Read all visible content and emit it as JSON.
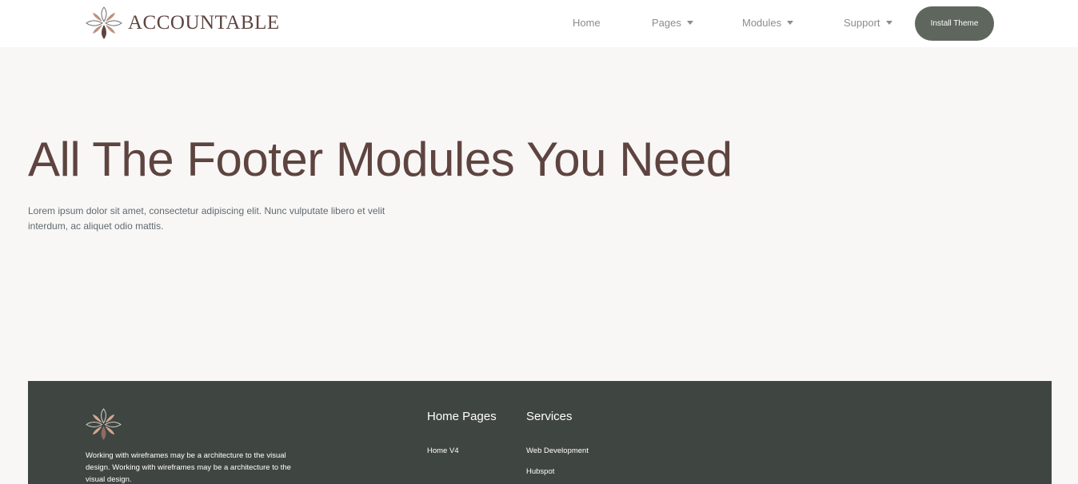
{
  "header": {
    "logo_text": "ACCOUNTABLE",
    "nav": [
      {
        "label": "Home"
      },
      {
        "label": "Pages"
      },
      {
        "label": "Modules"
      },
      {
        "label": "Support"
      }
    ],
    "cta_label": "Install Theme"
  },
  "hero": {
    "title": "All The Footer Modules You Need",
    "text": "Lorem ipsum dolor sit amet, consectetur adipiscing elit. Nunc vulputate libero et velit interdum, ac aliquet odio mattis."
  },
  "footer": {
    "description": "Working with wireframes may be a architecture to the visual design. Working with wireframes may be a architecture to the visual design.",
    "columns": [
      {
        "heading": "Home Pages",
        "links": [
          "Home V4"
        ]
      },
      {
        "heading": "Services",
        "links": [
          "Web Development",
          "Hubspot"
        ]
      }
    ]
  },
  "colors": {
    "brand": "#5e4440",
    "button": "#5f665e",
    "footer_bg": "#3f4541",
    "page_bg": "#f9f7f6",
    "petal_accent": "#b9927f"
  },
  "icons": {
    "logo": "flower-logo-icon",
    "dropdown": "caret-down-icon"
  }
}
